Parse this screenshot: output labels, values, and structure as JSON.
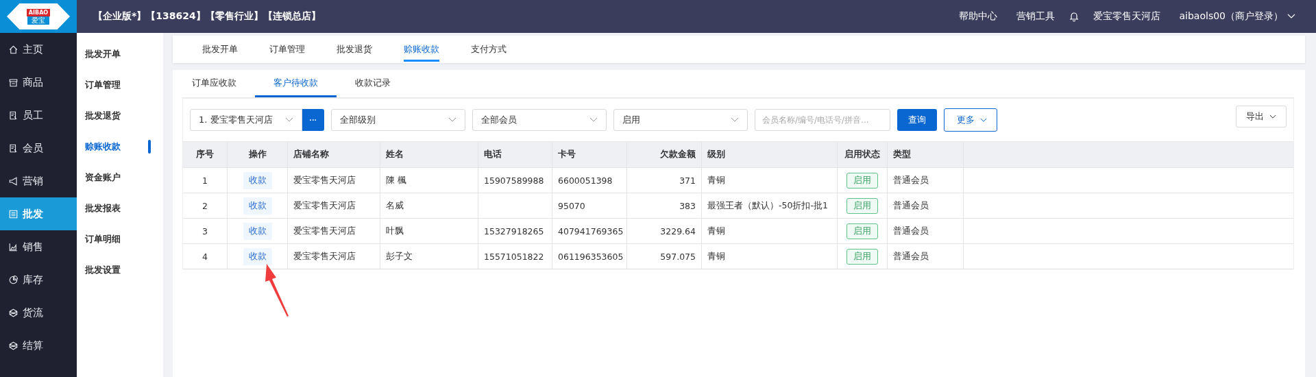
{
  "logo": {
    "top": "AIBAO",
    "bottom": "爱宝"
  },
  "header": {
    "account_info": "【企业版*】【138624】【零售行业】【连锁总店】",
    "links": [
      "帮助中心",
      "营销工具"
    ],
    "store": "爱宝零售天河店",
    "user": "aibaols00（商户登录）"
  },
  "sidebar": {
    "items": [
      {
        "label": "主页",
        "selected": false
      },
      {
        "label": "商品",
        "selected": false
      },
      {
        "label": "员工",
        "selected": false
      },
      {
        "label": "会员",
        "selected": false
      },
      {
        "label": "营销",
        "selected": false
      },
      {
        "label": "批发",
        "selected": true
      },
      {
        "label": "销售",
        "selected": false
      },
      {
        "label": "库存",
        "selected": false
      },
      {
        "label": "货流",
        "selected": false
      },
      {
        "label": "结算",
        "selected": false
      }
    ]
  },
  "submenu": {
    "items": [
      {
        "label": "批发开单",
        "selected": false
      },
      {
        "label": "订单管理",
        "selected": false
      },
      {
        "label": "批发退货",
        "selected": false
      },
      {
        "label": "赊账收款",
        "selected": true
      },
      {
        "label": "资金账户",
        "selected": false
      },
      {
        "label": "批发报表",
        "selected": false
      },
      {
        "label": "订单明细",
        "selected": false
      },
      {
        "label": "批发设置",
        "selected": false
      }
    ]
  },
  "tabs": [
    {
      "label": "批发开单",
      "selected": false
    },
    {
      "label": "订单管理",
      "selected": false
    },
    {
      "label": "批发退货",
      "selected": false
    },
    {
      "label": "赊账收款",
      "selected": true
    },
    {
      "label": "支付方式",
      "selected": false
    }
  ],
  "subtabs": [
    {
      "label": "订单应收款",
      "selected": false
    },
    {
      "label": "客户待收款",
      "selected": true
    },
    {
      "label": "收款记录",
      "selected": false
    }
  ],
  "filters": {
    "store": "1. 爱宝零售天河店",
    "more_dots": "···",
    "level": "全部级别",
    "member": "全部会员",
    "status": "启用",
    "search": {
      "placeholder": "会员名称/编号/电话号/拼音..."
    },
    "query": "查询",
    "more": "更多",
    "export": "导出"
  },
  "table": {
    "columns": [
      "序号",
      "操作",
      "店铺名称",
      "姓名",
      "电话",
      "卡号",
      "欠款金额",
      "级别",
      "启用状态",
      "类型"
    ],
    "rows": [
      {
        "index": "1",
        "action": "收款",
        "store": "爱宝零售天河店",
        "name": "陳  楓",
        "phone": "15907589988",
        "card": "6600051398",
        "debt": "371",
        "level": "青铜",
        "status": "启用",
        "type": "普通会员"
      },
      {
        "index": "2",
        "action": "收款",
        "store": "爱宝零售天河店",
        "name": "名威",
        "phone": "",
        "card": "95070",
        "debt": "383",
        "level": "最强王者（默认）-50折扣-批1",
        "status": "启用",
        "type": "普通会员"
      },
      {
        "index": "3",
        "action": "收款",
        "store": "爱宝零售天河店",
        "name": "叶飘",
        "phone": "15327918265",
        "card": "407941769365",
        "debt": "3229.64",
        "level": "青铜",
        "status": "启用",
        "type": "普通会员"
      },
      {
        "index": "4",
        "action": "收款",
        "store": "爱宝零售天河店",
        "name": "彭子文",
        "phone": "15571051822",
        "card": "061196353605",
        "debt": "597.075",
        "level": "青铜",
        "status": "启用",
        "type": "普通会员"
      }
    ]
  }
}
